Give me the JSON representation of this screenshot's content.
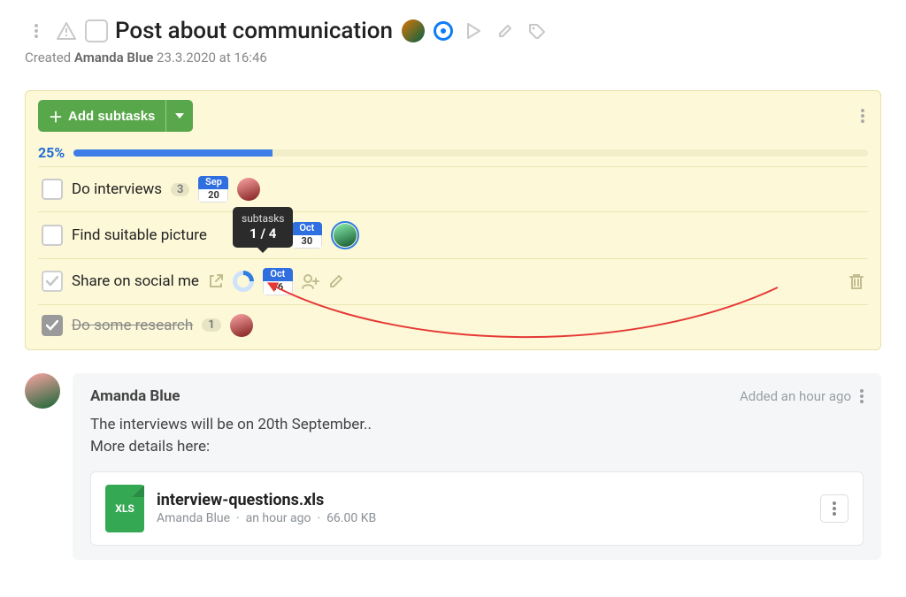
{
  "header": {
    "title": "Post about communication",
    "created_prefix": "Created",
    "created_by": "Amanda Blue",
    "created_at": "23.3.2020 at 16:46"
  },
  "subtasks": {
    "add_label": "Add subtasks",
    "progress_pct": "25%",
    "progress_value": 25,
    "tooltip_title": "subtasks",
    "tooltip_value": "1 / 4",
    "items": [
      {
        "label": "Do interviews",
        "count": "3",
        "date_month": "Sep",
        "date_day": "20",
        "done": false
      },
      {
        "label": "Find suitable picture",
        "count": "",
        "date_month": "Oct",
        "date_day": "30",
        "done": false
      },
      {
        "label": "Share on social me",
        "count": "",
        "date_month": "Oct",
        "date_day": "16",
        "done": false,
        "ring": true
      },
      {
        "label": "Do some research",
        "count": "1",
        "done": true
      }
    ]
  },
  "comment": {
    "user": "Amanda Blue",
    "time": "Added an hour ago",
    "line1": "The interviews will be on 20th September..",
    "line2": "More details here:",
    "file": {
      "ext": "XLS",
      "name": "interview-questions.xls",
      "uploader": "Amanda Blue",
      "age": "an hour ago",
      "size": "66.00 KB"
    }
  }
}
